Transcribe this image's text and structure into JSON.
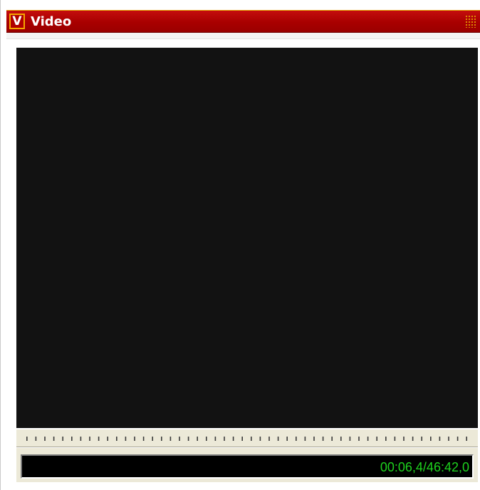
{
  "window": {
    "title": "Video",
    "logo_text": "V",
    "logo_icon": "app-logo-v-icon",
    "grip_icon": "window-grip-icon"
  },
  "player": {
    "timecode": "00:06,4/46:42,0"
  },
  "colors": {
    "titlebar": "#a80000",
    "logo_border": "#f6a600",
    "video_background": "#121212",
    "timecode_text": "#1ed21e",
    "timeline_background": "#ece9d8"
  }
}
